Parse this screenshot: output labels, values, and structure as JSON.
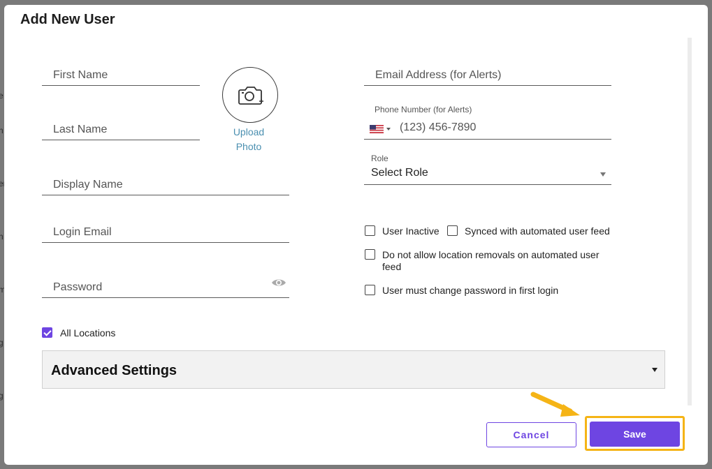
{
  "background": {
    "edge_fragments": [
      "e",
      "n",
      "er",
      "n",
      "m",
      "g",
      "g"
    ]
  },
  "modal": {
    "title": "Add New User"
  },
  "form": {
    "first_name_placeholder": "First Name",
    "last_name_placeholder": "Last Name",
    "display_name_placeholder": "Display Name",
    "login_email_placeholder": "Login Email",
    "password_placeholder": "Password",
    "upload_photo_line1": "Upload",
    "upload_photo_line2": "Photo",
    "email_alerts_placeholder": "Email Address (for Alerts)",
    "phone_label": "Phone Number (for Alerts)",
    "phone_placeholder": "(123) 456-7890",
    "role_label": "Role",
    "role_value": "Select Role",
    "user_inactive_label": "User Inactive",
    "user_inactive_checked": false,
    "synced_label": "Synced with automated user feed",
    "synced_checked": false,
    "no_location_removal_label": "Do not allow location removals on automated user feed",
    "no_location_removal_checked": false,
    "must_change_password_label": "User must change password in first login",
    "must_change_password_checked": false,
    "all_locations_label": "All Locations",
    "all_locations_checked": true
  },
  "advanced": {
    "title": "Advanced Settings"
  },
  "footer": {
    "cancel_label": "Cancel",
    "save_label": "Save"
  },
  "colors": {
    "accent": "#6e45e2",
    "link": "#4a8fb0",
    "highlight": "#f5b416"
  },
  "icons": {
    "camera": "camera-plus-icon",
    "eye": "eye-icon",
    "flag": "us-flag-icon"
  }
}
